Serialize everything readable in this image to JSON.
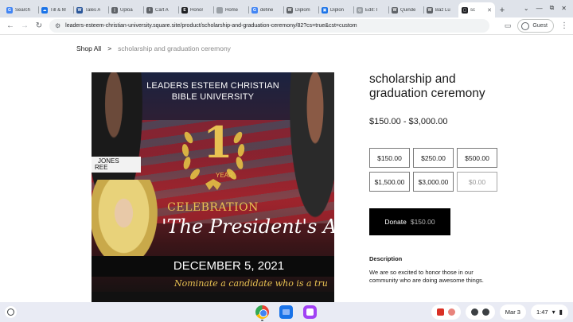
{
  "browser": {
    "tabs": [
      {
        "label": "Search",
        "color": "#4285f4",
        "glyph": "G"
      },
      {
        "label": "Till & M",
        "color": "#1a73e8",
        "glyph": "☁"
      },
      {
        "label": "Tales A",
        "color": "#2b579a",
        "glyph": "W"
      },
      {
        "label": "Uploa",
        "color": "#5f6368",
        "glyph": "▯"
      },
      {
        "label": "Cart A",
        "color": "#5f6368",
        "glyph": "i"
      },
      {
        "label": "Honor",
        "color": "#202124",
        "glyph": "E"
      },
      {
        "label": "Home",
        "color": "#9aa0a6",
        "glyph": ""
      },
      {
        "label": "define",
        "color": "#4285f4",
        "glyph": "G"
      },
      {
        "label": "Diplom",
        "color": "#5f6368",
        "glyph": "W"
      },
      {
        "label": "Diplon",
        "color": "#1a73e8",
        "glyph": "▣"
      },
      {
        "label": "Edit: I",
        "color": "#9aa0a6",
        "glyph": "◎"
      },
      {
        "label": "Quinde",
        "color": "#5f6368",
        "glyph": "W"
      },
      {
        "label": "Baz Lu",
        "color": "#5f6368",
        "glyph": "W"
      },
      {
        "label": "sc",
        "color": "#202124",
        "glyph": "▢",
        "active": true
      }
    ],
    "url": "leaders-esteem-christian-university.square.site/product/scholarship-and-graduation-ceremony/82?cs=true&cst=custom",
    "profile_label": "Guest"
  },
  "breadcrumb": {
    "shop_all": "Shop All",
    "separator": ">",
    "current": "scholarship and graduation ceremony"
  },
  "hero_image": {
    "school_line1": "LEADERS ESTEEM CHRISTIAN",
    "school_line2": "BIBLE UNIVERSITY",
    "name_card_line1": "JONES",
    "name_card_line2": "REE",
    "anniversary_number": "1",
    "anniversary_word": "YEAR",
    "celebration": "CELEBRATION",
    "award_script": "'The President's Awar",
    "date": "DECEMBER 5, 2021",
    "nominate": "Nominate a candidate who is a tru"
  },
  "product": {
    "title": "scholarship and graduation ceremony",
    "price_range": "$150.00 - $3,000.00",
    "amounts": [
      "$150.00",
      "$250.00",
      "$500.00",
      "$1,500.00",
      "$3,000.00"
    ],
    "custom_placeholder": "$0.00",
    "donate_label": "Donate",
    "donate_amount": "$150.00",
    "description_heading": "Description",
    "description": "We are so excited to honor those in our community who are doing awesome things."
  },
  "shelf": {
    "date": "Mar 3",
    "time": "1:47"
  }
}
